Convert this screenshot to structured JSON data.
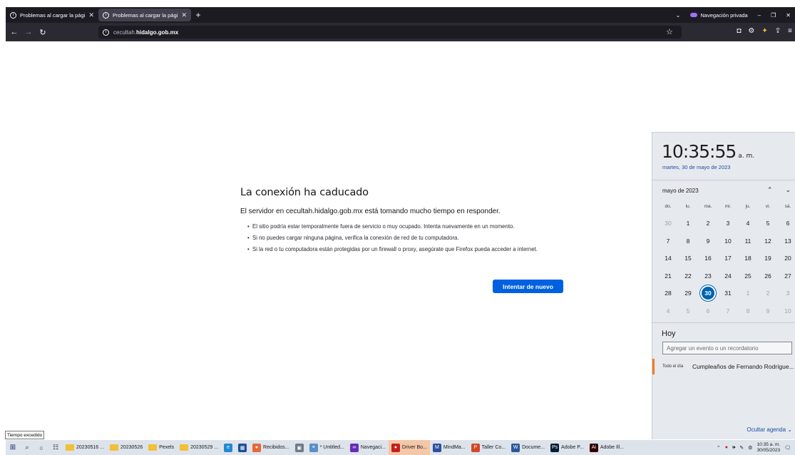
{
  "browser": {
    "tabs": [
      {
        "title": "Problemas al cargar la página",
        "active": false
      },
      {
        "title": "Problemas al cargar la página",
        "active": true
      }
    ],
    "private_label": "Navegación privada",
    "url_prefix": "cecultah.",
    "url_domain": "hidalgo.gob.mx"
  },
  "error": {
    "title": "La conexión ha caducado",
    "description": "El servidor en cecultah.hidalgo.gob.mx está tomando mucho tiempo en responder.",
    "bullets": [
      "El sitio podría estar temporalmente fuera de servicio o muy ocupado. Intenta nuevamente en un momento.",
      "Si no puedes cargar ninguna página, verifica la conexión de red de tu computadora.",
      "Si la red o tu computadora están protegidas por un firewall o proxy, asegúrate que Firefox pueda acceder a internet."
    ],
    "retry_label": "Intentar de nuevo"
  },
  "calendar": {
    "time": "10:35:55",
    "ampm": "a. m.",
    "date_full": "martes, 30 de mayo de 2023",
    "month_label": "mayo de 2023",
    "weekdays": [
      "do.",
      "lu.",
      "ma.",
      "mi.",
      "ju.",
      "vi.",
      "sá."
    ],
    "days": [
      {
        "n": "30",
        "other": true
      },
      {
        "n": "1"
      },
      {
        "n": "2"
      },
      {
        "n": "3"
      },
      {
        "n": "4"
      },
      {
        "n": "5"
      },
      {
        "n": "6"
      },
      {
        "n": "7"
      },
      {
        "n": "8"
      },
      {
        "n": "9"
      },
      {
        "n": "10"
      },
      {
        "n": "11"
      },
      {
        "n": "12"
      },
      {
        "n": "13"
      },
      {
        "n": "14"
      },
      {
        "n": "15"
      },
      {
        "n": "16"
      },
      {
        "n": "17"
      },
      {
        "n": "18"
      },
      {
        "n": "19"
      },
      {
        "n": "20"
      },
      {
        "n": "21"
      },
      {
        "n": "22"
      },
      {
        "n": "23"
      },
      {
        "n": "24"
      },
      {
        "n": "25"
      },
      {
        "n": "26"
      },
      {
        "n": "27"
      },
      {
        "n": "28"
      },
      {
        "n": "29"
      },
      {
        "n": "30",
        "today": true
      },
      {
        "n": "31"
      },
      {
        "n": "1",
        "other": true
      },
      {
        "n": "2",
        "other": true
      },
      {
        "n": "3",
        "other": true
      },
      {
        "n": "4",
        "other": true
      },
      {
        "n": "5",
        "other": true
      },
      {
        "n": "6",
        "other": true
      },
      {
        "n": "7",
        "other": true
      },
      {
        "n": "8",
        "other": true
      },
      {
        "n": "9",
        "other": true
      },
      {
        "n": "10",
        "other": true
      }
    ],
    "today_heading": "Hoy",
    "event_placeholder": "Agregar un evento o un recordatorio",
    "event_time": "Todo el día",
    "event_name": "Cumpleaños de Fernando Rodrígue...",
    "hide_agenda": "Ocultar agenda"
  },
  "tooltip": "Tiempo excedido",
  "taskbar": {
    "items": [
      {
        "label": "20230516 ...",
        "icon": "folder"
      },
      {
        "label": "20230526",
        "icon": "folder"
      },
      {
        "label": "Pexels",
        "icon": "folder"
      },
      {
        "label": "20230529 ...",
        "icon": "folder"
      },
      {
        "label": "",
        "icon": "edge"
      },
      {
        "label": "",
        "icon": "store"
      },
      {
        "label": "Recibidos...",
        "icon": "firefox"
      },
      {
        "label": "",
        "icon": "app"
      },
      {
        "label": "* Untitled...",
        "icon": "notepad"
      },
      {
        "label": "Navegaci...",
        "icon": "firefox-private"
      },
      {
        "label": "Driver Bo...",
        "icon": "driver",
        "active": true
      },
      {
        "label": "MindMa...",
        "icon": "mindmap"
      },
      {
        "label": "Taller Co...",
        "icon": "powerpoint"
      },
      {
        "label": "Docume...",
        "icon": "word"
      },
      {
        "label": "Adobe P...",
        "icon": "photoshop",
        "abbr": "Ps"
      },
      {
        "label": "Adobe Ill...",
        "icon": "illustrator",
        "abbr": "Ai"
      }
    ],
    "clock_time": "10:35 a. m.",
    "clock_date": "30/05/2023"
  },
  "colors": {
    "accent": "#0061e0",
    "today": "#0063b1",
    "event_bar": "#f07b28"
  }
}
